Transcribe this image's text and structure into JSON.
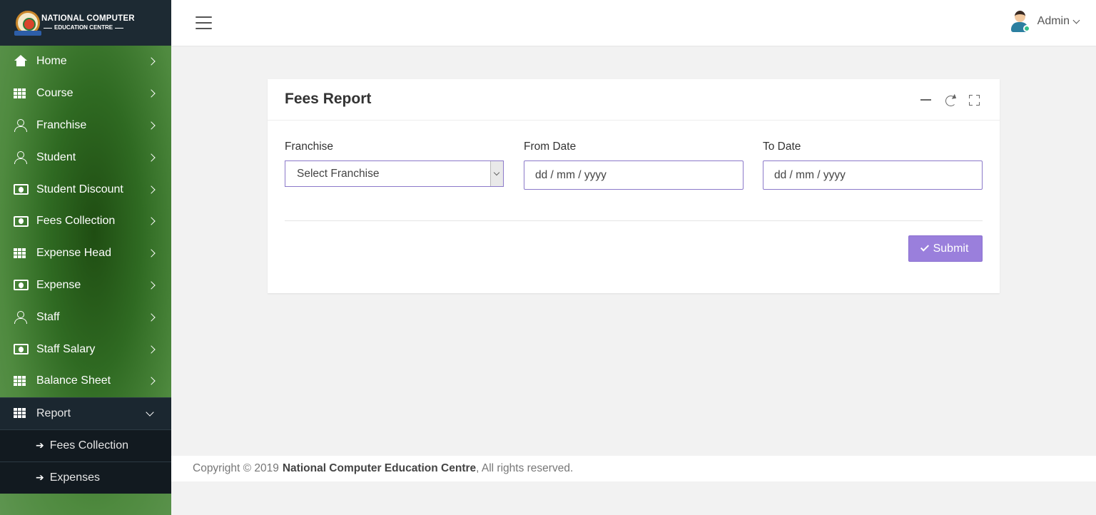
{
  "brand": {
    "line1": "NATIONAL COMPUTER",
    "line2": "EDUCATION CENTRE"
  },
  "sidebar": {
    "items": [
      {
        "label": "Home",
        "icon": "home-icon"
      },
      {
        "label": "Course",
        "icon": "grid-icon"
      },
      {
        "label": "Franchise",
        "icon": "user-icon"
      },
      {
        "label": "Student",
        "icon": "user-icon"
      },
      {
        "label": "Student Discount",
        "icon": "money-icon"
      },
      {
        "label": "Fees Collection",
        "icon": "money-icon"
      },
      {
        "label": "Expense Head",
        "icon": "grid-icon"
      },
      {
        "label": "Expense",
        "icon": "money-icon"
      },
      {
        "label": "Staff",
        "icon": "user-icon"
      },
      {
        "label": "Staff Salary",
        "icon": "money-icon"
      },
      {
        "label": "Balance Sheet",
        "icon": "grid-icon"
      },
      {
        "label": "Report",
        "icon": "grid-icon",
        "expanded": true
      }
    ],
    "report_submenu": [
      {
        "label": "Fees Collection"
      },
      {
        "label": "Expenses"
      }
    ]
  },
  "header": {
    "user_name": "Admin"
  },
  "card": {
    "title": "Fees Report",
    "franchise_label": "Franchise",
    "franchise_selected": "Select Franchise",
    "from_label": "From Date",
    "from_placeholder": "dd / mm / yyyy",
    "to_label": "To Date",
    "to_placeholder": "dd / mm / yyyy",
    "submit_label": "Submit"
  },
  "footer": {
    "prefix": "Copyright © 2019",
    "org": "National Computer Education Centre",
    "suffix": ", All rights reserved."
  },
  "colors": {
    "accent": "#9a7fdc",
    "sidebar_dark": "#1d2a33",
    "sidebar_green": "#4f8a3f"
  }
}
